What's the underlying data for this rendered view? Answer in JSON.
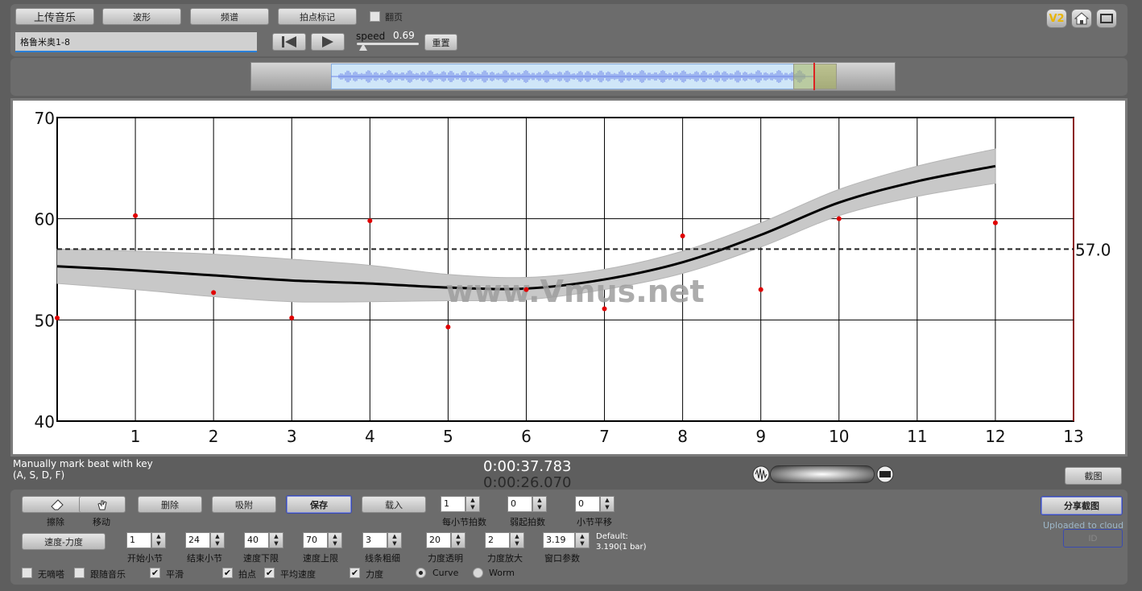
{
  "toolbar": {
    "upload": "上传音乐",
    "waveform": "波形",
    "spectrum": "频谱",
    "beat_mark": "拍点标记",
    "flip_page": "翻页",
    "song_title": "格鲁米奥1-8",
    "speed_label": "speed",
    "speed_value": "0.69",
    "reset": "重置",
    "v2": "V2"
  },
  "chart_data": {
    "type": "line",
    "x_ticks": [
      "1",
      "2",
      "3",
      "4",
      "5",
      "6",
      "7",
      "8",
      "9",
      "10",
      "11",
      "12",
      "13"
    ],
    "y_ticks": [
      "40",
      "50",
      "60",
      "70"
    ],
    "xlim": [
      0,
      13
    ],
    "ylim": [
      40,
      70
    ],
    "grid": true,
    "reference_line": {
      "value": 57.0,
      "label": "57.0"
    },
    "watermark": "www.Vmus.net",
    "points": [
      {
        "x": 0,
        "y": 50.2
      },
      {
        "x": 1,
        "y": 60.3
      },
      {
        "x": 2,
        "y": 52.7
      },
      {
        "x": 3,
        "y": 50.2
      },
      {
        "x": 4,
        "y": 59.8
      },
      {
        "x": 5,
        "y": 49.3
      },
      {
        "x": 6,
        "y": 53.0
      },
      {
        "x": 7,
        "y": 51.1
      },
      {
        "x": 8,
        "y": 58.3
      },
      {
        "x": 9,
        "y": 53.0
      },
      {
        "x": 10,
        "y": 60.0
      },
      {
        "x": 12,
        "y": 59.6
      }
    ],
    "curve": [
      {
        "x": 0,
        "y": 55.3
      },
      {
        "x": 1,
        "y": 54.9
      },
      {
        "x": 2,
        "y": 54.4
      },
      {
        "x": 3,
        "y": 53.9
      },
      {
        "x": 4,
        "y": 53.6
      },
      {
        "x": 5,
        "y": 53.2
      },
      {
        "x": 6,
        "y": 53.1
      },
      {
        "x": 7,
        "y": 54.0
      },
      {
        "x": 8,
        "y": 55.7
      },
      {
        "x": 9,
        "y": 58.4
      },
      {
        "x": 10,
        "y": 61.6
      },
      {
        "x": 11,
        "y": 63.7
      },
      {
        "x": 12,
        "y": 65.2
      }
    ],
    "band_half_width": [
      1.7,
      1.9,
      2.1,
      2.1,
      1.8,
      1.3,
      1.1,
      1.0,
      1.1,
      1.2,
      1.3,
      1.5,
      1.7
    ]
  },
  "status": {
    "hint_line1": "Manually mark beat with key",
    "hint_line2": "(A, S, D, F)",
    "time_current": "0:00:37.783",
    "time_total": "0:00:26.070",
    "screenshot": "截图"
  },
  "controls": {
    "erase": "擦除",
    "move": "移动",
    "delete": "删除",
    "snap": "吸附",
    "save": "保存",
    "load": "载入",
    "beats_per_bar_label": "每小节拍数",
    "beats_per_bar": "1",
    "pickup_label": "弱起拍数",
    "pickup": "0",
    "bar_shift_label": "小节平移",
    "bar_shift": "0",
    "share": "分享截图",
    "uploaded": "Uploaded to cloud",
    "id_label": "ID",
    "mode": "速度-力度",
    "start_bar_label": "开始小节",
    "start_bar": "1",
    "end_bar_label": "结束小节",
    "end_bar": "24",
    "tempo_min_label": "速度下限",
    "tempo_min": "40",
    "tempo_max_label": "速度上限",
    "tempo_max": "70",
    "line_width_label": "线条粗细",
    "line_width": "3",
    "dyn_alpha_label": "力度透明",
    "dyn_alpha": "20",
    "dyn_zoom_label": "力度放大",
    "dyn_zoom": "2",
    "window_label": "窗口参数",
    "window": "3.19",
    "default_line1": "Default:",
    "default_line2": "3.190(1 bar)",
    "metronome": "无嘀嗒",
    "follow_music": "跟随音乐",
    "smooth": "平滑",
    "beat_points": "拍点",
    "avg_tempo": "平均速度",
    "dynamics": "力度",
    "curve": "Curve",
    "worm": "Worm"
  }
}
